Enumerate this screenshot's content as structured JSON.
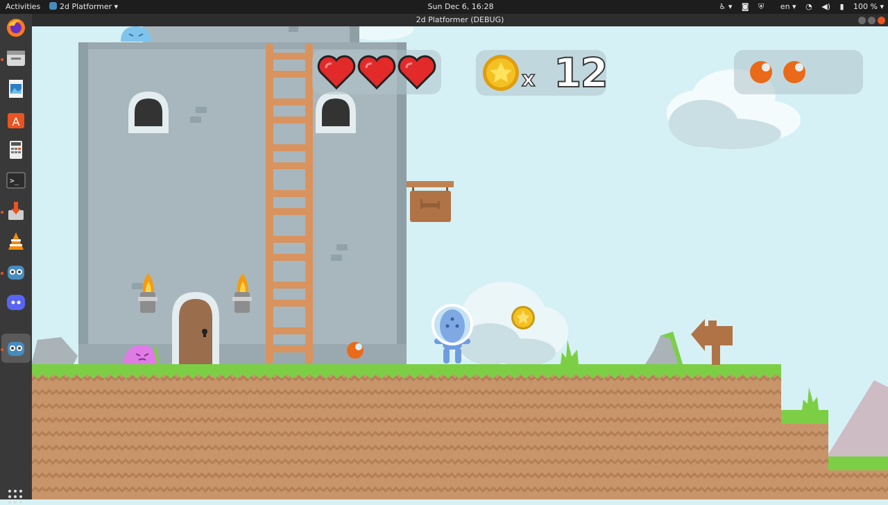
{
  "topbar": {
    "activities": "Activities",
    "app_name": "2d Platformer",
    "clock": "Sun Dec  6, 16:28",
    "language": "en",
    "battery": "100 %"
  },
  "dock": {
    "apps": [
      "firefox-icon",
      "files-icon",
      "image-viewer-icon",
      "software-center-icon",
      "calculator-icon",
      "terminal-icon",
      "installer-icon",
      "vlc-icon",
      "godot-icon",
      "discord-icon",
      "godot-active-icon"
    ],
    "show_apps_icon": "grid-icon"
  },
  "window": {
    "title": "2d Platformer (DEBUG)"
  },
  "hud": {
    "hearts": 3,
    "coin_multiplier": "x",
    "coin_count": "12",
    "orbs": 2
  },
  "colors": {
    "sky": "#d5f1f5",
    "grass": "#7ccf45",
    "dirt": "#c8946a",
    "heart": "#e22a2a",
    "coin": "#f5c022",
    "orb": "#ea6a1a",
    "castle": "#a8b7bd"
  }
}
